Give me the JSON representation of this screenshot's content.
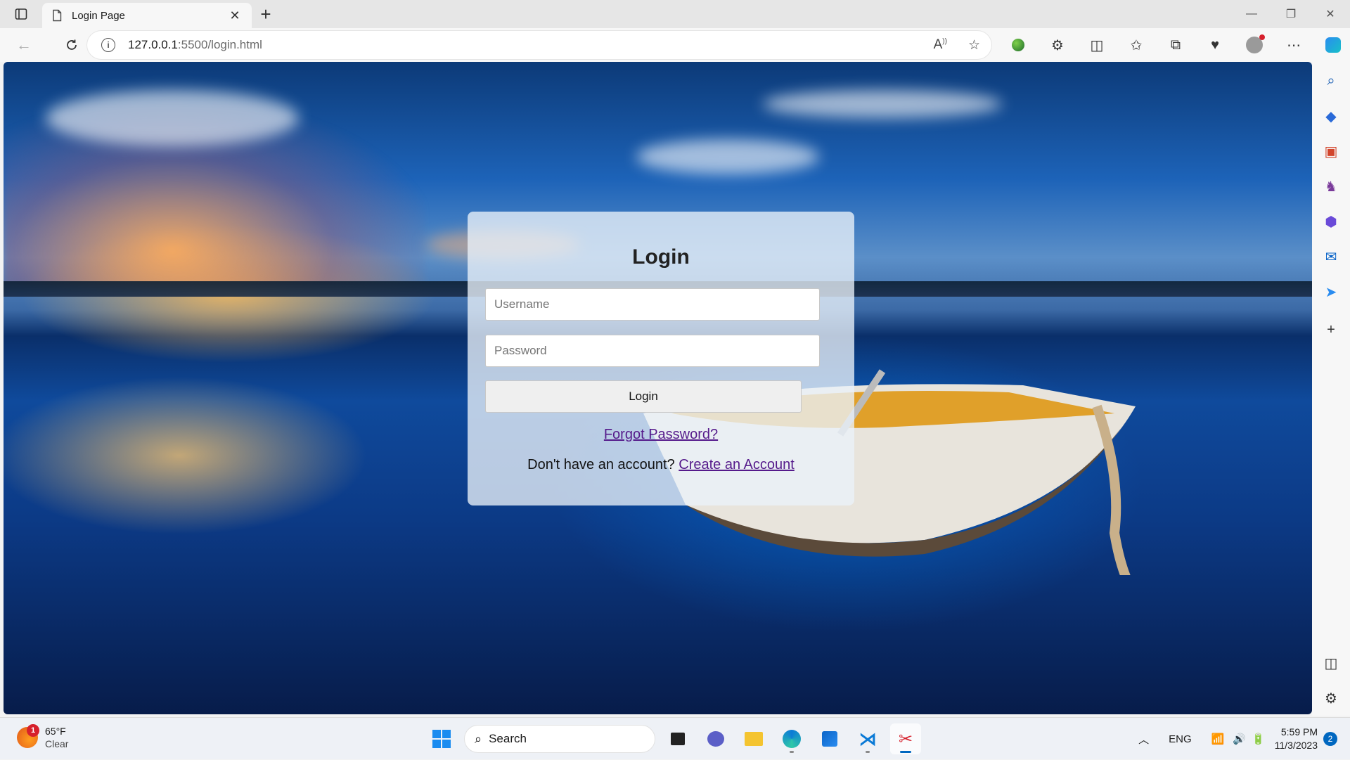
{
  "browser": {
    "tab_title": "Login Page",
    "url_host": "127.0.0.1",
    "url_path": ":5500/login.html"
  },
  "login": {
    "heading": "Login",
    "username_placeholder": "Username",
    "password_placeholder": "Password",
    "button_label": "Login",
    "forgot_link": "Forgot Password?",
    "signup_prompt": "Don't have an account?",
    "signup_link": "Create an Account"
  },
  "taskbar": {
    "weather_badge": "1",
    "weather_temp": "65°F",
    "weather_condition": "Clear",
    "search_label": "Search",
    "language": "ENG",
    "time": "5:59 PM",
    "date": "11/3/2023",
    "notification_count": "2"
  },
  "colors": {
    "link": "#551a8b",
    "accent": "#0067c0",
    "card_bg": "rgba(235,242,250,0.78)"
  },
  "icons": {
    "sidebar": [
      "search-icon",
      "tag-icon",
      "toolbox-icon",
      "chess-icon",
      "copilot-office-icon",
      "outlook-icon",
      "send-icon",
      "add-icon",
      "panel-icon",
      "settings-icon"
    ],
    "taskbar": [
      "windows-start-icon",
      "task-view-icon",
      "teams-chat-icon",
      "file-explorer-icon",
      "edge-icon",
      "store-icon",
      "vscode-icon",
      "snipping-tool-icon"
    ]
  }
}
